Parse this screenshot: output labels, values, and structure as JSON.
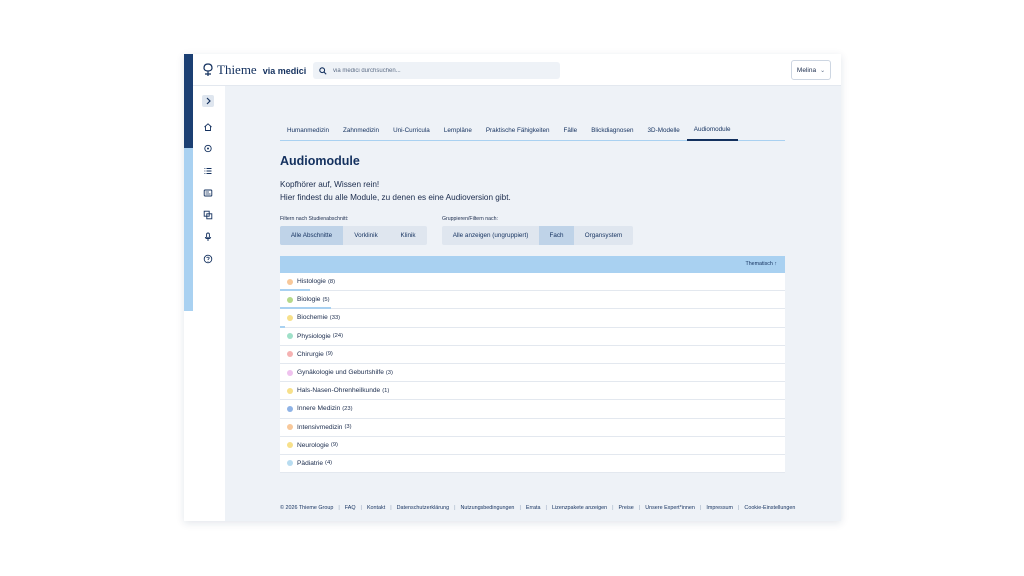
{
  "header": {
    "brand": "Thieme",
    "brand_sub": "via medici",
    "search_placeholder": "via medici durchsuchen...",
    "user_name": "Melina"
  },
  "colors": {
    "navy": "#13305e",
    "accent": "#a9d1f1",
    "background": "#eef2f7"
  },
  "rail_icons": [
    "chevron-right-icon",
    "home-icon",
    "location-icon",
    "list-icon",
    "card-icon",
    "copy-icon",
    "microphone-icon",
    "help-icon"
  ],
  "tabs": [
    "Humanmedizin",
    "Zahnmedizin",
    "Uni-Curricula",
    "Lernpläne",
    "Praktische Fähigkeiten",
    "Fälle",
    "Blickdiagnosen",
    "3D-Modelle",
    "Audiomodule"
  ],
  "active_tab": "Audiomodule",
  "page": {
    "title": "Audiomodule",
    "intro_line1": "Kopfhörer auf, Wissen rein!",
    "intro_line2": "Hier findest du alle Module, zu denen es eine Audioversion gibt."
  },
  "filters": {
    "study_label": "Filtern nach Studienabschnitt:",
    "study_options": [
      "Alle Abschnitte",
      "Vorklinik",
      "Klinik"
    ],
    "study_selected": "Alle Abschnitte",
    "group_label": "Gruppieren/Filtern nach:",
    "group_options": [
      "Alle anzeigen (ungruppiert)",
      "Fach",
      "Organsystem"
    ],
    "group_selected": "Fach"
  },
  "table": {
    "sort_label": "Thematisch",
    "rows": [
      {
        "label": "Histologie",
        "count": "(8)",
        "color": "#f8c89a",
        "progress": 0.06
      },
      {
        "label": "Biologie",
        "count": "(5)",
        "color": "#b5d98a",
        "progress": 0.1
      },
      {
        "label": "Biochemie",
        "count": "(33)",
        "color": "#f7e08a",
        "progress": 0.01
      },
      {
        "label": "Physiologie",
        "count": "(24)",
        "color": "#9fe0c8",
        "progress": 0
      },
      {
        "label": "Chirurgie",
        "count": "(9)",
        "color": "#f5b2b2",
        "progress": 0
      },
      {
        "label": "Gynäkologie und Geburtshilfe",
        "count": "(3)",
        "color": "#efc2ee",
        "progress": 0
      },
      {
        "label": "Hals-Nasen-Ohrenheilkunde",
        "count": "(1)",
        "color": "#f7e08a",
        "progress": 0
      },
      {
        "label": "Innere Medizin",
        "count": "(23)",
        "color": "#8fb3e6",
        "progress": 0
      },
      {
        "label": "Intensivmedizin",
        "count": "(3)",
        "color": "#f8c89a",
        "progress": 0
      },
      {
        "label": "Neurologie",
        "count": "(9)",
        "color": "#f7e08a",
        "progress": 0
      },
      {
        "label": "Pädiatrie",
        "count": "(4)",
        "color": "#b8dcf0",
        "progress": 0
      }
    ]
  },
  "footer": {
    "copyright": "© 2026 Thieme Group",
    "links": [
      "FAQ",
      "Kontakt",
      "Datenschutzerklärung",
      "Nutzungsbedingungen",
      "Errata",
      "Lizenzpakete anzeigen",
      "Preise",
      "Unsere Expert*innen",
      "Impressum",
      "Cookie-Einstellungen"
    ]
  }
}
